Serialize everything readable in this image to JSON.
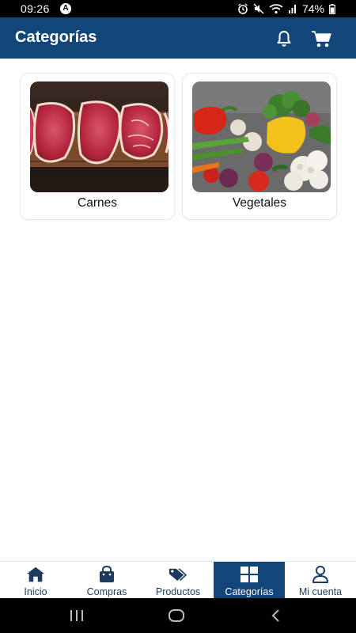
{
  "status_bar": {
    "time": "09:26",
    "battery": "74%",
    "icons": [
      "alarm-icon",
      "mute-icon",
      "wifi-icon",
      "signal-icon",
      "battery-icon"
    ]
  },
  "app_bar": {
    "title": "Categorías",
    "actions": [
      "bell-icon",
      "cart-icon"
    ],
    "background": "#124578"
  },
  "categories": [
    {
      "label": "Carnes",
      "image": "raw-steaks-on-board"
    },
    {
      "label": "Vegetales",
      "image": "assorted-vegetables"
    }
  ],
  "bottom_nav": {
    "active_index": 3,
    "items": [
      {
        "label": "Inicio",
        "icon": "home-icon"
      },
      {
        "label": "Compras",
        "icon": "shopping-bag-icon"
      },
      {
        "label": "Productos",
        "icon": "tags-icon"
      },
      {
        "label": "Categorías",
        "icon": "grid-icon"
      },
      {
        "label": "Mi cuenta",
        "icon": "user-icon"
      }
    ]
  },
  "colors": {
    "primary": "#124578",
    "icon_dark": "#1e3b5e"
  }
}
